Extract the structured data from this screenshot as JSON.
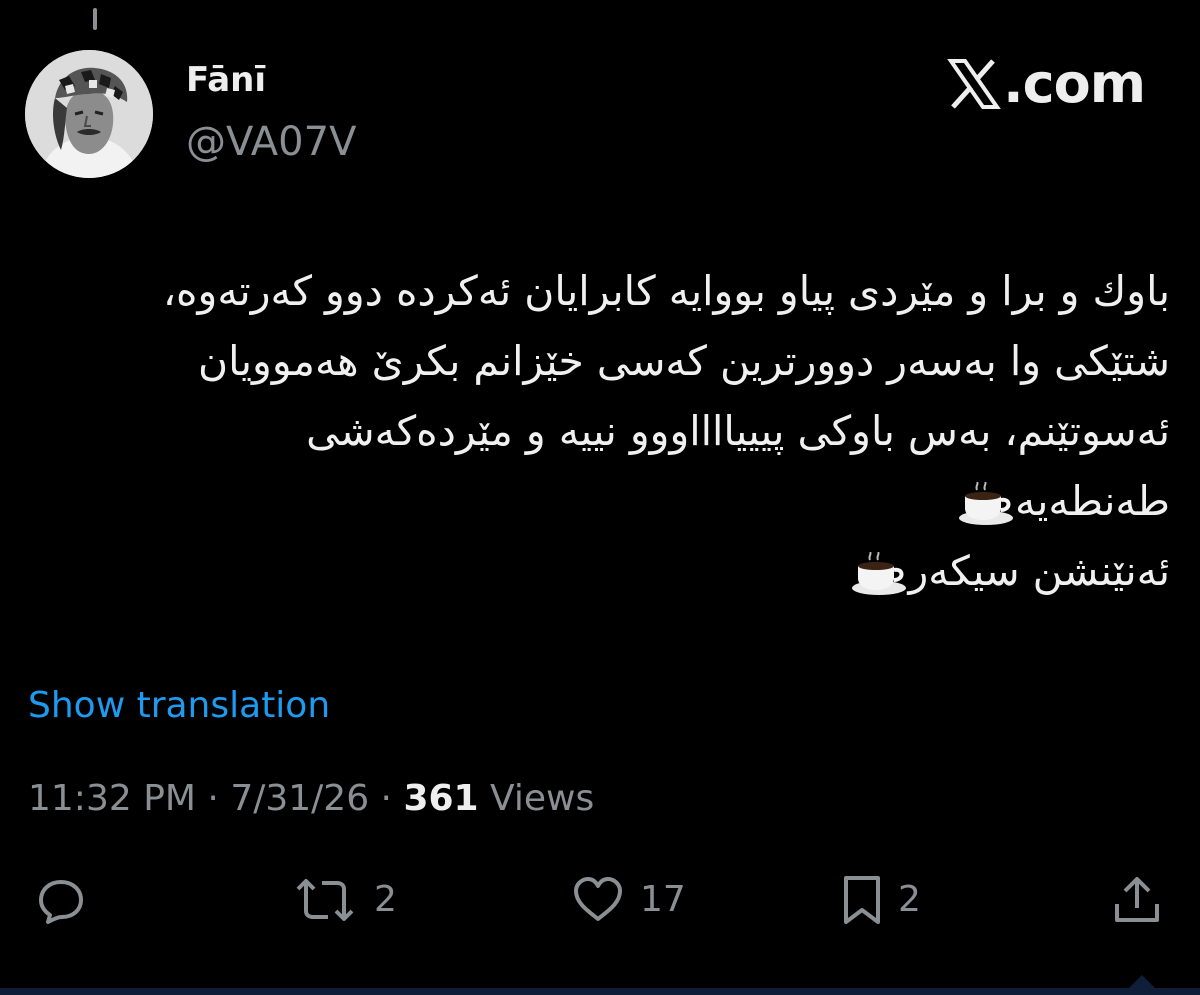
{
  "author": {
    "display_name": "Fānī",
    "handle": "@VA07V",
    "avatar_icon": "avatar-photo"
  },
  "brand": {
    "icon": "x-logo-icon",
    "text": ".com"
  },
  "tweet": {
    "lines": [
      "باوك و برا و مێردی پیاو بووایە كابرایان ئەكردە دوو كەرتەوە،",
      "شتێكی وا بەسەر دوورترین كەسی خێزانم بكرێ هەموویان",
      "ئەسوتێنم، بەس باوكی پیییااااووو نییە و مێردەكەشی",
      "طەنطەیە",
      "ئەنێنشن سیکەر"
    ],
    "emoji_icon": "hot-beverage-icon"
  },
  "show_translation_label": "Show translation",
  "meta": {
    "time": "11:32 PM",
    "separator": " · ",
    "date": "7/31/26",
    "views_count": "361",
    "views_label": "Views"
  },
  "actions": {
    "reply_count": "",
    "retweet_count": "2",
    "like_count": "17",
    "bookmark_count": "2"
  },
  "colors": {
    "background": "#000000",
    "text_primary": "#e7e9ea",
    "text_secondary": "#8a8f94",
    "accent": "#1d9bf0"
  }
}
